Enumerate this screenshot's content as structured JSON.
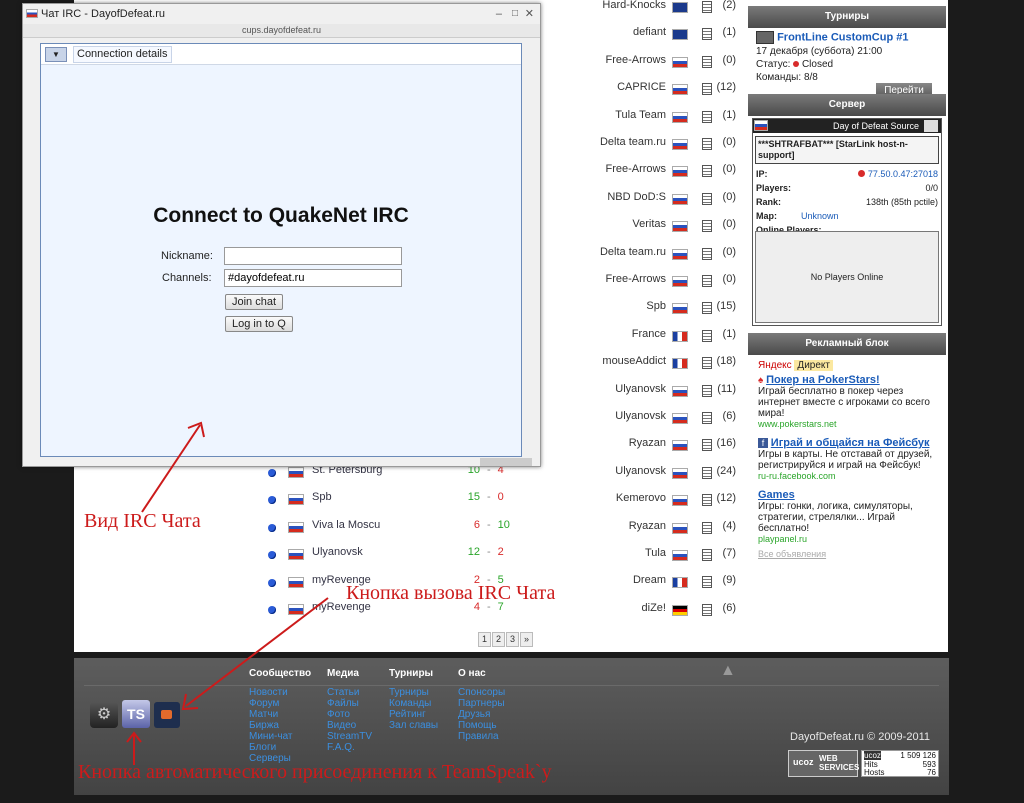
{
  "irc": {
    "window_title": "Чат IRC - DayofDefeat.ru",
    "url": "cups.dayofdefeat.ru",
    "tab_label": "Connection details",
    "heading": "Connect to QuakeNet IRC",
    "nickname_label": "Nickname:",
    "nickname_value": "",
    "channels_label": "Channels:",
    "channels_value": "#dayofdefeat.ru",
    "join_button": "Join chat",
    "login_button": "Log in to Q"
  },
  "matches": [
    {
      "team": "St. Petersburg",
      "score_a": "10",
      "score_b": "4",
      "a_color": "win",
      "b_color": "lose"
    },
    {
      "team": "Spb",
      "score_a": "15",
      "score_b": "0",
      "a_color": "win",
      "b_color": "lose"
    },
    {
      "team": "Viva la Moscu",
      "score_a": "6",
      "score_b": "10",
      "a_color": "lose",
      "b_color": "win"
    },
    {
      "team": "Ulyanovsk",
      "score_a": "12",
      "score_b": "2",
      "a_color": "win",
      "b_color": "lose"
    },
    {
      "team": "myRevenge",
      "score_a": "2",
      "score_b": "5",
      "a_color": "lose",
      "b_color": "win"
    },
    {
      "team": "myRevenge",
      "score_a": "4",
      "score_b": "7",
      "a_color": "lose",
      "b_color": "win"
    }
  ],
  "score_separator": "-",
  "teams": [
    {
      "name": "Hard-Knocks",
      "flag": "eu",
      "count": "(2)"
    },
    {
      "name": "defiant",
      "flag": "eu",
      "count": "(1)"
    },
    {
      "name": "Free-Arrows",
      "flag": "ru",
      "count": "(0)"
    },
    {
      "name": "CAPRICE",
      "flag": "ru",
      "count": "(12)"
    },
    {
      "name": "Tula Team",
      "flag": "ru",
      "count": "(1)"
    },
    {
      "name": "Delta team.ru",
      "flag": "ru",
      "count": "(0)"
    },
    {
      "name": "Free-Arrows",
      "flag": "ru",
      "count": "(0)"
    },
    {
      "name": "NBD DoD:S",
      "flag": "ru",
      "count": "(0)"
    },
    {
      "name": "Veritas",
      "flag": "ru",
      "count": "(0)"
    },
    {
      "name": "Delta team.ru",
      "flag": "ru",
      "count": "(0)"
    },
    {
      "name": "Free-Arrows",
      "flag": "ru",
      "count": "(0)"
    },
    {
      "name": "Spb",
      "flag": "ru",
      "count": "(15)"
    },
    {
      "name": "France",
      "flag": "fr",
      "count": "(1)"
    },
    {
      "name": "mouseAddict",
      "flag": "fr",
      "count": "(18)"
    },
    {
      "name": "Ulyanovsk",
      "flag": "ru",
      "count": "(11)"
    },
    {
      "name": "Ulyanovsk",
      "flag": "ru",
      "count": "(6)"
    },
    {
      "name": "Ryazan",
      "flag": "ru",
      "count": "(16)"
    },
    {
      "name": "Ulyanovsk",
      "flag": "ru",
      "count": "(24)"
    },
    {
      "name": "Kemerovo",
      "flag": "ru",
      "count": "(12)"
    },
    {
      "name": "Ryazan",
      "flag": "ru",
      "count": "(4)"
    },
    {
      "name": "Tula",
      "flag": "ru",
      "count": "(7)"
    },
    {
      "name": "Dream",
      "flag": "fr",
      "count": "(9)"
    },
    {
      "name": "diZe!",
      "flag": "de",
      "count": "(6)"
    }
  ],
  "pager": [
    "1",
    "2",
    "3",
    "»"
  ],
  "sidebar": {
    "tournaments": {
      "header": "Турниры",
      "name": "FrontLine CustomCup #1",
      "date": "17 декабря (суббота) 21:00",
      "status_label": "Статус:",
      "status_value": "Closed",
      "teams_label": "Команды:",
      "teams_value": "8/8",
      "go_button": "Перейти"
    },
    "server": {
      "header": "Сервер",
      "game": "Day of Defeat Source",
      "name": "***SHTRAFBAT*** [StarLink host-n-support]",
      "ip_label": "IP:",
      "ip_value": "77.50.0.47:27018",
      "players_label": "Players:",
      "players_value": "0/0",
      "rank_label": "Rank:",
      "rank_value": "138th (85th pctile)",
      "map_label": "Map:",
      "map_value": "Unknown",
      "online_label": "Online Players:",
      "no_players": "No Players Online"
    },
    "ads": {
      "header": "Рекламный блок",
      "yandex": "Яндекс",
      "direct": "Директ",
      "ad1_title": "Покер на PokerStars!",
      "ad1_text": "Играй бесплатно в покер через интернет вместе с игроками со всего мира!",
      "ad1_url": "www.pokerstars.net",
      "ad2_title": "Играй и общайся на Фейсбук",
      "ad2_text": "Игры в карты. Не отставай от друзей, регистрируйся и играй на Фейсбук!",
      "ad2_url": "ru-ru.facebook.com",
      "ad3_title": "Games",
      "ad3_text": "Игры: гонки, логика, симуляторы, стратегии, стрелялки... Играй бесплатно!",
      "ad3_url": "playpanel.ru",
      "all_ads": "Все объявления"
    }
  },
  "footer": {
    "columns": [
      {
        "title": "Сообщество",
        "links": [
          "Новости",
          "Форум",
          "Матчи",
          "Биржа",
          "Мини-чат",
          "Блоги",
          "Серверы"
        ]
      },
      {
        "title": "Медиа",
        "links": [
          "Статьи",
          "Файлы",
          "Фото",
          "Видео",
          "StreamTV",
          "F.A.Q."
        ]
      },
      {
        "title": "Турниры",
        "links": [
          "Турниры",
          "Команды",
          "Рейтинг",
          "Зал славы"
        ]
      },
      {
        "title": "О нас",
        "links": [
          "Спонсоры",
          "Партнеры",
          "Друзья",
          "Помощь",
          "Правила"
        ]
      }
    ],
    "copyright": "DayofDefeat.ru © 2009-2011",
    "ucoz_label": "ucoz",
    "web_services": "WEB SERVICES",
    "counter_total": "1 509 126",
    "hits_label": "Hits",
    "hits_value": "593",
    "hosts_label": "Hosts",
    "hosts_value": "76"
  },
  "annotations": {
    "irc_view": "Вид IRC Чата",
    "irc_button": "Кнопка вызова IRC Чата",
    "teamspeak": "Кнопка автоматического присоединения к TeamSpeak`y"
  },
  "colors": {
    "win": "#2aa52a",
    "lose": "#d82b2b",
    "link": "#1a5bb8",
    "annotation": "#cc1b1b"
  }
}
